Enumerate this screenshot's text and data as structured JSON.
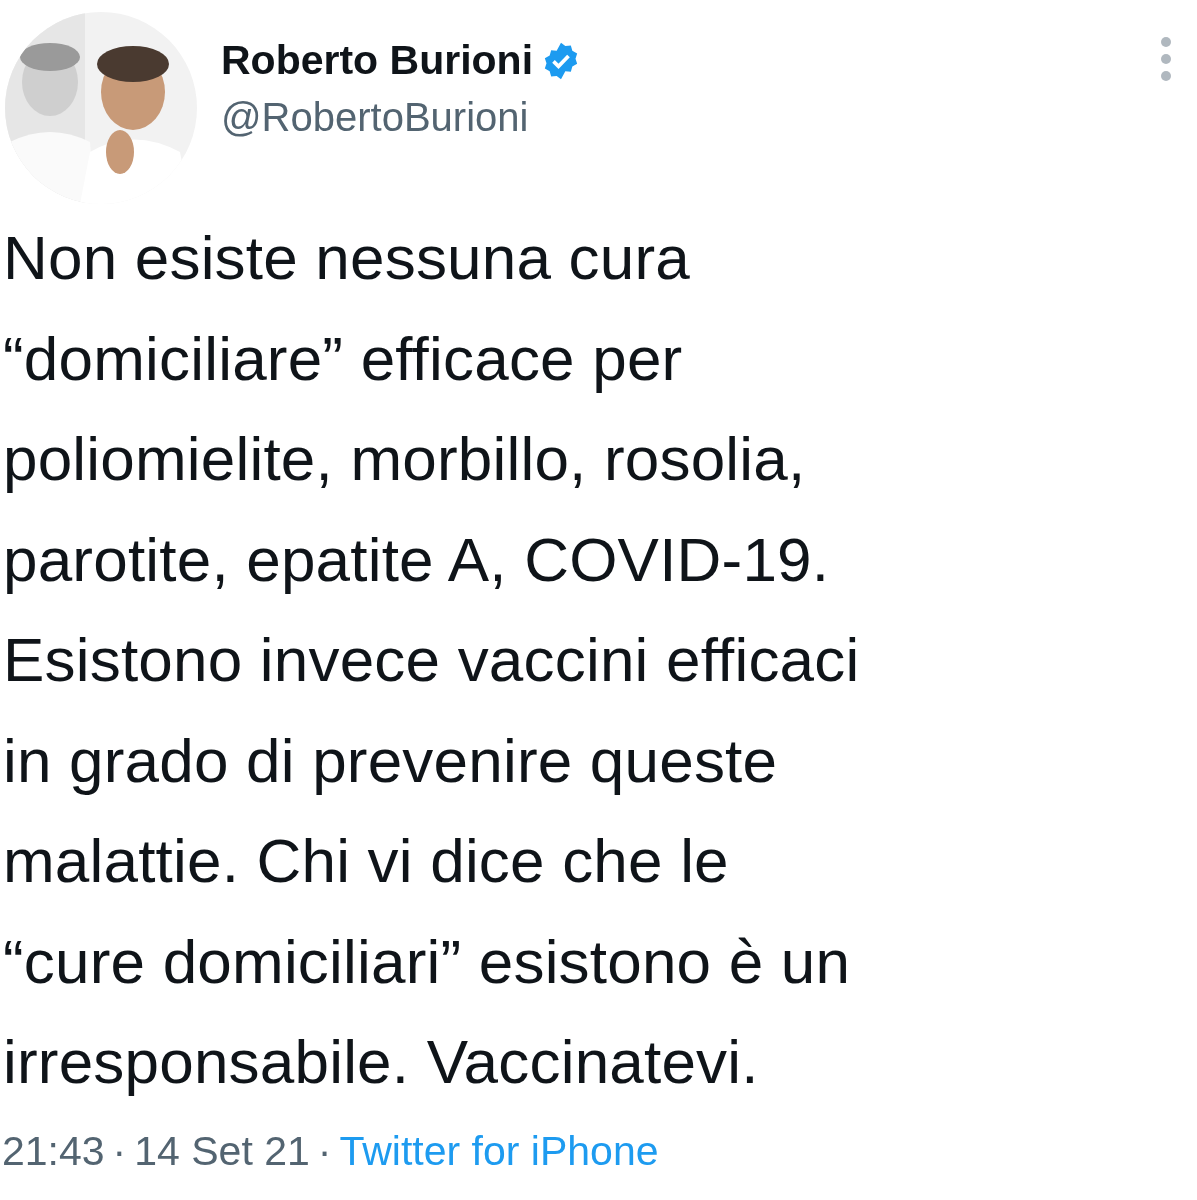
{
  "author": {
    "name": "Roberto Burioni",
    "verified": true,
    "handle": "@RobertoBurioni"
  },
  "tweet": {
    "text": "Non esiste nessuna cura\n“domiciliare” efficace per\npoliomielite, morbillo, rosolia,\nparotite, epatite A, COVID-19.\nEsistono invece vaccini efficaci\nin grado di prevenire queste\nmalattie. Chi vi dice che le\n“cure domiciliari” esistono è un\nirresponsabile. Vaccinatevi."
  },
  "meta": {
    "time": "21:43",
    "separator_1": "·",
    "date": "14 Set 21",
    "separator_2": "·",
    "source": "Twitter for iPhone"
  }
}
